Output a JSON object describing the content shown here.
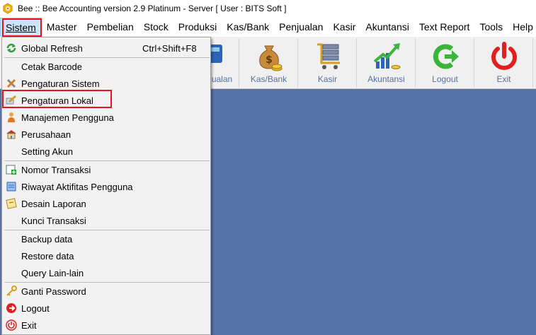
{
  "window": {
    "title": "Bee :: Bee Accounting version 2.9 Platinum - Server  [ User : BITS Soft ]",
    "icon": "bee-logo-icon"
  },
  "menubar": {
    "items": [
      {
        "label": "Sistem",
        "active": true
      },
      {
        "label": "Master"
      },
      {
        "label": "Pembelian"
      },
      {
        "label": "Stock"
      },
      {
        "label": "Produksi"
      },
      {
        "label": "Kas/Bank"
      },
      {
        "label": "Penjualan"
      },
      {
        "label": "Kasir"
      },
      {
        "label": "Akuntansi"
      },
      {
        "label": "Text Report"
      },
      {
        "label": "Tools"
      },
      {
        "label": "Help"
      }
    ]
  },
  "toolbar": {
    "buttons": [
      {
        "label": "ualan",
        "icon": "sales-icon"
      },
      {
        "label": "Kas/Bank",
        "icon": "money-bag-icon"
      },
      {
        "label": "Kasir",
        "icon": "cashier-cart-icon"
      },
      {
        "label": "Akuntansi",
        "icon": "chart-growth-icon"
      },
      {
        "label": "Logout",
        "icon": "logout-arrow-icon"
      },
      {
        "label": "Exit",
        "icon": "power-icon"
      }
    ]
  },
  "dropdown": {
    "items": [
      {
        "label": "Global Refresh",
        "shortcut": "Ctrl+Shift+F8",
        "icon": "refresh-icon"
      },
      {
        "label": "Cetak Barcode",
        "icon": ""
      },
      {
        "label": "Pengaturan Sistem",
        "icon": "tools-icon"
      },
      {
        "label": "Pengaturan Lokal",
        "icon": "pencil-edit-icon",
        "highlighted": true
      },
      {
        "label": "Manajemen Pengguna",
        "icon": "user-icon"
      },
      {
        "label": "Perusahaan",
        "icon": "building-icon"
      },
      {
        "label": "Setting Akun",
        "icon": ""
      },
      {
        "label": "Nomor Transaksi",
        "icon": "add-document-icon"
      },
      {
        "label": "Riwayat Aktifitas Pengguna",
        "icon": "history-icon"
      },
      {
        "label": "Desain Laporan",
        "icon": "report-design-icon"
      },
      {
        "label": "Kunci Transaksi",
        "icon": ""
      },
      {
        "label": "Backup data",
        "icon": ""
      },
      {
        "label": "Restore data",
        "icon": ""
      },
      {
        "label": "Query Lain-lain",
        "icon": ""
      },
      {
        "label": "Ganti Password",
        "icon": "key-icon"
      },
      {
        "label": "Logout",
        "icon": "logout-icon"
      },
      {
        "label": "Exit",
        "icon": "exit-icon"
      }
    ]
  },
  "colors": {
    "highlight_box": "#e8121f",
    "workspace": "#5672a9",
    "menu_active_bg": "#cce4f7"
  }
}
